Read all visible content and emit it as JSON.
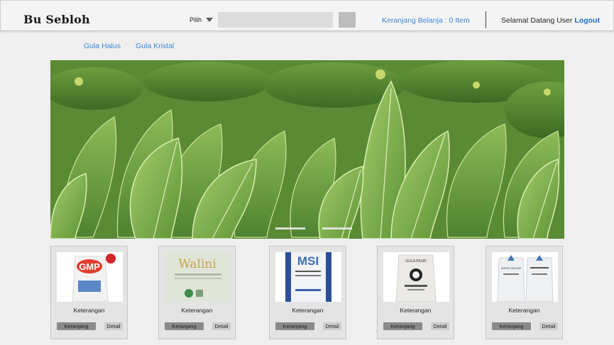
{
  "header": {
    "brand": "Bu Sebloh",
    "select_label": "Pilih",
    "search_placeholder": "",
    "cart_text": "Keranjang Belanja : 0 Item",
    "greeting": "Selamat Datang User",
    "logout_label": "Logout"
  },
  "nav": {
    "items": [
      {
        "label": "Gula Halus"
      },
      {
        "label": "Gula Kristal"
      }
    ]
  },
  "carousel": {
    "indicator_count": 2,
    "active_index": 0
  },
  "products": [
    {
      "brand_text": "GMP",
      "description": "Keterangan",
      "cart_label": "Keranjang",
      "detail_label": "Detail"
    },
    {
      "brand_text": "Walini",
      "description": "Keterangan",
      "cart_label": "Keranjang",
      "detail_label": "Detail"
    },
    {
      "brand_text": "MSI",
      "description": "Keterangan",
      "cart_label": "Keranjang",
      "detail_label": "Detail"
    },
    {
      "brand_text": "GULA PASIR",
      "description": "Keterangan",
      "cart_label": "Keranjang",
      "detail_label": "Detail"
    },
    {
      "brand_text": "WHITE SUGAR",
      "description": "Keterangan",
      "cart_label": "Keranjang",
      "detail_label": "Detail"
    }
  ],
  "colors": {
    "link": "#3b86d6",
    "logout": "#1d6cc7",
    "cart_button": "#8a8a8a",
    "detail_button": "#cdcdcd"
  }
}
